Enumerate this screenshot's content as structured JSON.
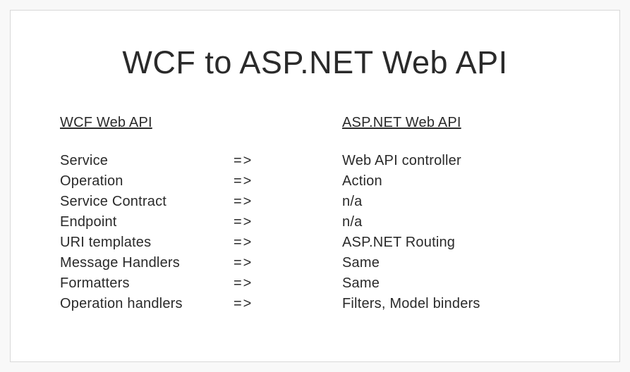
{
  "title": "WCF to ASP.NET Web API",
  "headers": {
    "left": "WCF Web API",
    "right": "ASP.NET Web API"
  },
  "arrow": "=>",
  "rows": [
    {
      "left": "Service",
      "right": "Web API controller"
    },
    {
      "left": "Operation",
      "right": "Action"
    },
    {
      "left": "Service Contract",
      "right": "n/a"
    },
    {
      "left": "Endpoint",
      "right": "n/a"
    },
    {
      "left": "URI templates",
      "right": "ASP.NET Routing"
    },
    {
      "left": "Message Handlers",
      "right": "Same"
    },
    {
      "left": "Formatters",
      "right": "Same"
    },
    {
      "left": "Operation handlers",
      "right": "Filters, Model binders"
    }
  ]
}
